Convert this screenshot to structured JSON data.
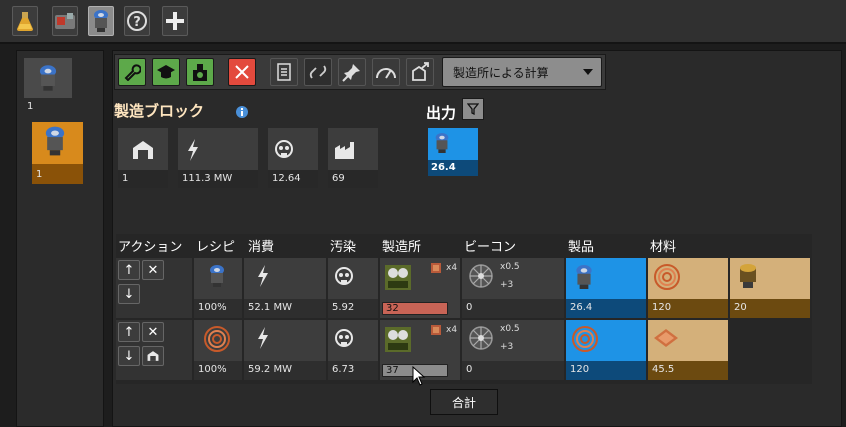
{
  "left_panel": {
    "items": [
      {
        "icon": "electric-mining-drill-icon",
        "count": "1"
      },
      {
        "icon": "electric-mining-drill-icon",
        "count": "1"
      }
    ]
  },
  "toolbar": {
    "buttons": [
      "wrench",
      "graduation-cap",
      "nuclear",
      "close",
      "document",
      "link",
      "pin",
      "speedometer",
      "export"
    ],
    "dropdown_label": "製造所による計算"
  },
  "block": {
    "title": "製造ブロック",
    "output_title": "出力",
    "stats": [
      {
        "icon": "building-icon",
        "value": "1"
      },
      {
        "icon": "lightning-icon",
        "value": "111.3 MW"
      },
      {
        "icon": "pollution-icon",
        "value": "12.64"
      },
      {
        "icon": "factory-icon",
        "value": "69"
      }
    ],
    "output": {
      "icon": "electric-mining-drill-icon",
      "value": "26.4"
    }
  },
  "table": {
    "headers": [
      "アクション",
      "レシピ",
      "消費",
      "汚染",
      "製造所",
      "ビーコン",
      "製品",
      "材料"
    ],
    "rows": [
      {
        "recipe_pct": "100%",
        "energy": "52.1 MW",
        "pollution": "5.92",
        "machine_count": "32",
        "machine_fill": 1.0,
        "modules": "x4",
        "beacon_count": "0",
        "beacon_mult": "x0.5",
        "beacon_add": "+3",
        "product": "26.4",
        "materials": [
          "120",
          "20"
        ]
      },
      {
        "recipe_pct": "100%",
        "energy": "59.2 MW",
        "pollution": "6.73",
        "machine_count": "37",
        "machine_fill": 1.0,
        "modules": "x4",
        "beacon_count": "0",
        "beacon_mult": "x0.5",
        "beacon_add": "+3",
        "product": "120",
        "materials": [
          "45.5"
        ]
      }
    ]
  },
  "tooltip": "合計",
  "colors": {
    "product_blue": "#1e93e6",
    "material_tan": "#d4b07a",
    "green_btn": "#5da94a",
    "red_btn": "#e34a3d",
    "bar_red": "#c86456",
    "bar_grey": "#8c8c8c"
  }
}
